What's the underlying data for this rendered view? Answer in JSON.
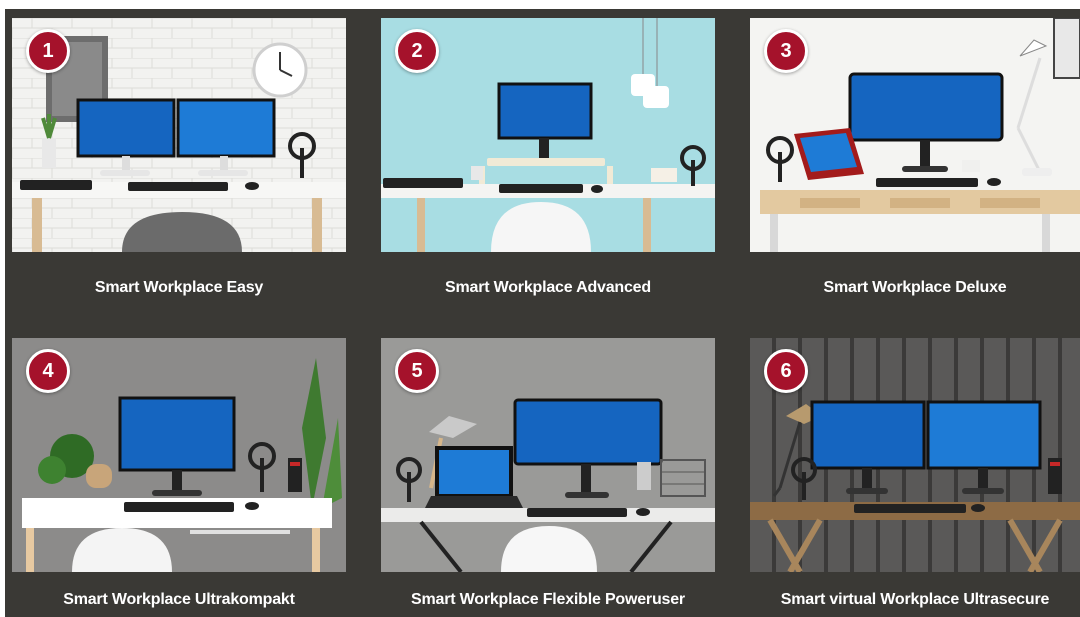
{
  "colors": {
    "background": "#3a3935",
    "badge": "#a5122b",
    "caption_text": "#ffffff",
    "screen_blue": "#1565c0"
  },
  "cards": [
    {
      "number": "1",
      "title": "Smart Workplace Easy"
    },
    {
      "number": "2",
      "title": "Smart Workplace Advanced"
    },
    {
      "number": "3",
      "title": "Smart Workplace Deluxe"
    },
    {
      "number": "4",
      "title": "Smart Workplace Ultrakompakt"
    },
    {
      "number": "5",
      "title": "Smart Workplace Flexible Poweruser"
    },
    {
      "number": "6",
      "title": "Smart virtual Workplace Ultrasecure"
    }
  ]
}
